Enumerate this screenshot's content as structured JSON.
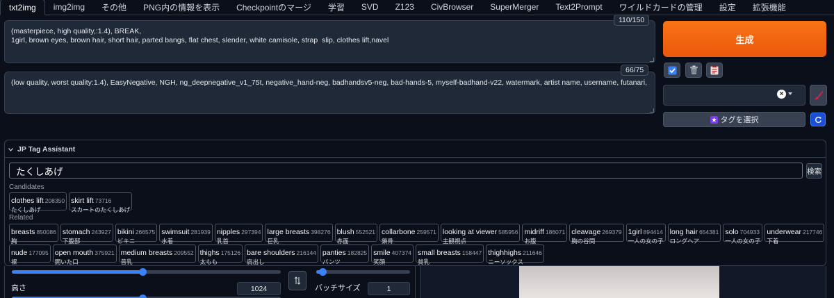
{
  "tabs": [
    "txt2img",
    "img2img",
    "その他",
    "PNG内の情報を表示",
    "Checkpointのマージ",
    "学習",
    "SVD",
    "Z123",
    "CivBrowser",
    "SuperMerger",
    "Text2Prompt",
    "ワイルドカードの管理",
    "設定",
    "拡張機能"
  ],
  "active_tab": "txt2img",
  "prompt": {
    "text": "(masterpiece, high quality,:1.4), BREAK,\n1girl, brown eyes, brown hair, short hair, parted bangs, flat chest, slender, white camisole, strap  slip, clothes lift,navel",
    "counter": "110/150"
  },
  "negative_prompt": {
    "text": "(low quality, worst quality:1.4), EasyNegative, NGH, ng_deepnegative_v1_75t, negative_hand-neg, badhandsv5-neg, bad-hands-5, myself-badhand-v22, watermark, artist name, username, futanari,",
    "counter": "66/75"
  },
  "generate_label": "生成",
  "tag_select_label": "タグを選択",
  "tag_assistant": {
    "title": "JP Tag Assistant",
    "query": "たくしあげ",
    "search_label": "検索",
    "candidates_label": "Candidates",
    "related_label": "Related",
    "candidates": [
      {
        "en": "clothes lift",
        "count": "208350",
        "ja": "たくしあげ"
      },
      {
        "en": "skirt lift",
        "count": "73716",
        "ja": "スカートのたくしあげ"
      }
    ],
    "related_row1": [
      {
        "en": "breasts",
        "count": "850086",
        "ja": "胸"
      },
      {
        "en": "stomach",
        "count": "243927",
        "ja": "下腹部"
      },
      {
        "en": "bikini",
        "count": "266575",
        "ja": "ビキニ"
      },
      {
        "en": "swimsuit",
        "count": "281939",
        "ja": "水着"
      },
      {
        "en": "nipples",
        "count": "297394",
        "ja": "乳首"
      },
      {
        "en": "large breasts",
        "count": "398276",
        "ja": "巨乳"
      },
      {
        "en": "blush",
        "count": "552521",
        "ja": "赤面"
      },
      {
        "en": "collarbone",
        "count": "259571",
        "ja": "鎖骨"
      },
      {
        "en": "looking at viewer",
        "count": "585956",
        "ja": "主観視点"
      },
      {
        "en": "midriff",
        "count": "186071",
        "ja": "お腹"
      },
      {
        "en": "cleavage",
        "count": "269379",
        "ja": "胸の谷間"
      },
      {
        "en": "1girl",
        "count": "894414",
        "ja": "一人の女の子"
      },
      {
        "en": "long hair",
        "count": "654381",
        "ja": "ロングヘア"
      },
      {
        "en": "solo",
        "count": "704933",
        "ja": "一人の女の子"
      },
      {
        "en": "underwear",
        "count": "217746",
        "ja": "下着"
      }
    ],
    "related_row2": [
      {
        "en": "nude",
        "count": "177095",
        "ja": "裸"
      },
      {
        "en": "open mouth",
        "count": "375921",
        "ja": "開いた口"
      },
      {
        "en": "medium breasts",
        "count": "209552",
        "ja": "普乳"
      },
      {
        "en": "thighs",
        "count": "175126",
        "ja": "太もも"
      },
      {
        "en": "bare shoulders",
        "count": "216144",
        "ja": "肩出し"
      },
      {
        "en": "panties",
        "count": "182825",
        "ja": "パンツ"
      },
      {
        "en": "smile",
        "count": "407374",
        "ja": "笑顔"
      },
      {
        "en": "small breasts",
        "count": "158447",
        "ja": "貧乳"
      },
      {
        "en": "thighhighs",
        "count": "211646",
        "ja": "ニーソックス"
      }
    ]
  },
  "height_label": "高さ",
  "height_value": "1024",
  "batch_size_label": "バッチサイズ",
  "batch_size_value": "1",
  "colors": {
    "accent": "#3b82f6",
    "generate": "#f97316",
    "background": "#0b0f19"
  }
}
